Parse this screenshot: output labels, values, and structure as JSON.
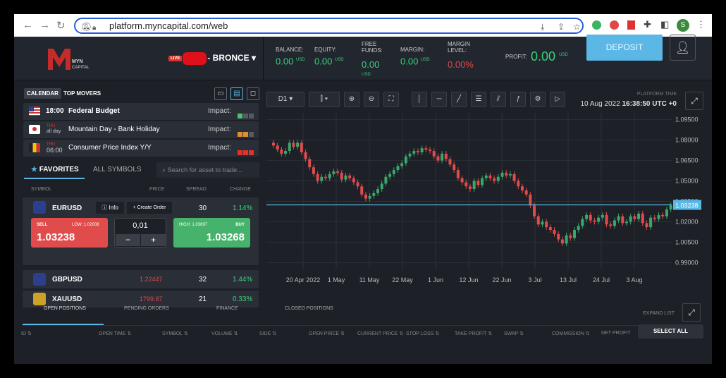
{
  "browser": {
    "url": "platform.myncapital.com/web",
    "avatar_letter": "S"
  },
  "header": {
    "logo_text": "MYN CAPITAL",
    "live_label": "LIVE",
    "account_suffix": "- BRONCE",
    "stats": [
      {
        "label": "BALANCE:",
        "value": "0.00",
        "unit": "USD"
      },
      {
        "label": "EQUITY:",
        "value": "0.00",
        "unit": "USD"
      },
      {
        "label": "FREE FUNDS:",
        "value": "0.00",
        "unit": "USD"
      },
      {
        "label": "MARGIN:",
        "value": "0.00",
        "unit": "USD"
      },
      {
        "label": "MARGIN LEVEL:",
        "value": "0.00%",
        "unit": ""
      }
    ],
    "profit_label": "PROFIT:",
    "profit_value": "0.00",
    "profit_unit": "USD",
    "deposit_label": "DEPOSIT"
  },
  "calendar": {
    "tab_calendar": "CALENDAR",
    "tab_top_movers": "TOP MOVERS",
    "events": [
      {
        "time": "18:00",
        "day": "",
        "name": "Federal Budget",
        "impact_label": "Impact:",
        "impact_colors": [
          "#49c46a",
          "#555a63",
          "#555a63"
        ]
      },
      {
        "time": "all day",
        "day": "THU",
        "name": "Mountain Day - Bank Holiday",
        "impact_label": "Impact:",
        "impact_colors": [
          "#e0902a",
          "#e0902a",
          "#555a63"
        ]
      },
      {
        "time": "06:00",
        "day": "THU",
        "name": "Consumer Price Index Y/Y",
        "impact_label": "Impact:",
        "impact_colors": [
          "#e0342a",
          "#e0342a",
          "#e0342a"
        ]
      }
    ]
  },
  "symbols": {
    "tab_favorites": "FAVORITES",
    "tab_all": "ALL SYMBOLS",
    "search_placeholder": "Search for asset to trade...",
    "columns": [
      "SYMBOL",
      "PRICE",
      "SPREAD",
      "CHANGE"
    ],
    "expanded": {
      "symbol": "EURUSD",
      "info": "Info",
      "create_order": "Create Order",
      "spread": "30",
      "change": "1.14%",
      "sell_label": "SELL",
      "low_label": "LOW: 1.02008",
      "sell_price": "1.03238",
      "qty": "0,01",
      "high_label": "HIGH: 1.03697",
      "buy_label": "BUY",
      "buy_price": "1.03268"
    },
    "rows": [
      {
        "symbol": "GBPUSD",
        "price": "1.22447",
        "spread": "32",
        "change": "1.44%"
      },
      {
        "symbol": "XAUUSD",
        "price": "1799.87",
        "spread": "21",
        "change": "0.33%"
      }
    ]
  },
  "chart_toolbar": {
    "timeframe": "D1",
    "platform_time_label": "PLATFORM TIME",
    "date": "10 Aug 2022",
    "time": "16:38:50 UTC +0"
  },
  "chart_data": {
    "type": "candlestick",
    "x_ticks": [
      "20 Apr 2022",
      "1 May",
      "11 May",
      "22 May",
      "1 Jun",
      "12 Jun",
      "22 Jun",
      "3 Jul",
      "13 Jul",
      "24 Jul",
      "3 Aug"
    ],
    "y_ticks": [
      "1.09500",
      "1.08000",
      "1.06500",
      "1.05000",
      "1.03500",
      "1.02000",
      "1.00500",
      "0.99000"
    ],
    "ylim": [
      0.985,
      1.1
    ],
    "current_price": "1.03238",
    "closes": [
      1.076,
      1.073,
      1.07,
      1.072,
      1.078,
      1.075,
      1.078,
      1.071,
      1.066,
      1.06,
      1.055,
      1.05,
      1.053,
      1.052,
      1.055,
      1.057,
      1.056,
      1.051,
      1.054,
      1.052,
      1.049,
      1.046,
      1.04,
      1.037,
      1.039,
      1.041,
      1.044,
      1.048,
      1.053,
      1.055,
      1.058,
      1.061,
      1.063,
      1.068,
      1.07,
      1.072,
      1.071,
      1.074,
      1.073,
      1.072,
      1.068,
      1.065,
      1.07,
      1.066,
      1.062,
      1.058,
      1.052,
      1.049,
      1.046,
      1.044,
      1.05,
      1.047,
      1.052,
      1.054,
      1.052,
      1.05,
      1.053,
      1.056,
      1.054,
      1.055,
      1.05,
      1.046,
      1.043,
      1.04,
      1.032,
      1.024,
      1.018,
      1.02,
      1.016,
      1.014,
      1.011,
      1.007,
      1.004,
      1.01,
      1.008,
      1.014,
      1.017,
      1.022,
      1.025,
      1.021,
      1.02,
      1.023,
      1.025,
      1.018,
      1.017,
      1.021,
      1.024,
      1.019,
      1.02,
      1.024,
      1.022,
      1.026,
      1.019,
      1.016,
      1.023,
      1.022,
      1.025,
      1.024,
      1.029,
      1.032
    ]
  },
  "bottom": {
    "tabs": [
      "OPEN POSITIONS",
      "PENDING ORDERS",
      "FINANCE",
      "CLOSED POSITIONS"
    ],
    "expand_list": "EXPAND LIST",
    "select_all": "SELECT ALL",
    "columns": [
      "ID",
      "OPEN TIME",
      "SYMBOL",
      "VOLUME",
      "SIDE",
      "OPEN PRICE",
      "CURRENT PRICE",
      "STOP LOSS",
      "TAKE PROFIT",
      "SWAP",
      "COMMISSION",
      "NET PROFIT"
    ]
  }
}
